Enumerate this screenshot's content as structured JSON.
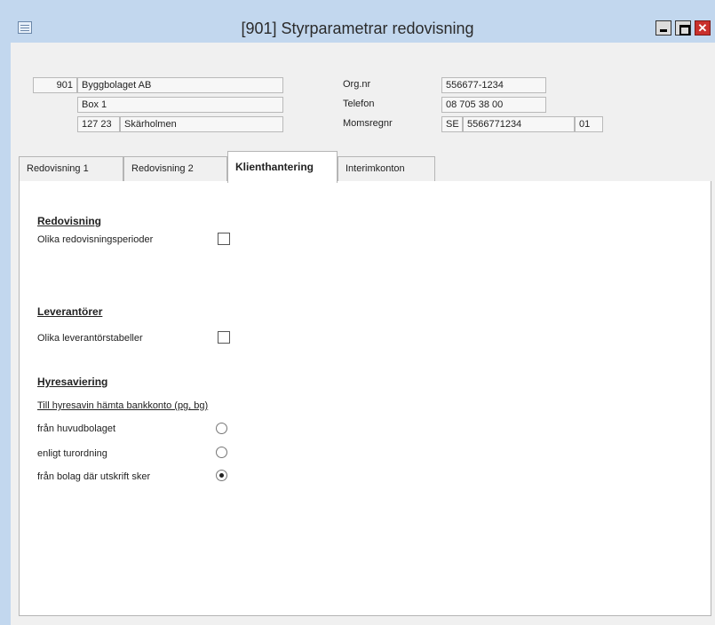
{
  "window": {
    "title": "[901]  Styrparametrar redovisning",
    "close_glyph": "✕"
  },
  "company": {
    "number": "901",
    "name": "Byggbolaget AB",
    "address": "Box 1",
    "postal_code": "127 23",
    "city": "Skärholmen"
  },
  "org": {
    "orgnr_label": "Org.nr",
    "orgnr_value": "556677-1234",
    "phone_label": "Telefon",
    "phone_value": "08 705 38 00",
    "vat_label": "Momsregnr",
    "vat_prefix": "SE",
    "vat_number": "5566771234",
    "vat_suffix": "01"
  },
  "tabs": [
    {
      "label": "Redovisning 1",
      "active": false
    },
    {
      "label": "Redovisning 2",
      "active": false
    },
    {
      "label": "Klienthantering",
      "active": true
    },
    {
      "label": "Interimkonton",
      "active": false
    }
  ],
  "panel": {
    "redovisning": {
      "heading": "Redovisning",
      "option_label": "Olika redovisningsperioder",
      "checked": false
    },
    "leverantorer": {
      "heading": "Leverantörer",
      "option_label": "Olika leverantörstabeller",
      "checked": false
    },
    "hyresaviering": {
      "heading": "Hyresaviering",
      "subheading": "Till hyresavin hämta bankkonto (pg, bg)",
      "options": [
        {
          "label": "från huvudbolaget",
          "selected": false
        },
        {
          "label": "enligt turordning",
          "selected": false
        },
        {
          "label": "från bolag där utskrift sker",
          "selected": true
        }
      ]
    }
  }
}
